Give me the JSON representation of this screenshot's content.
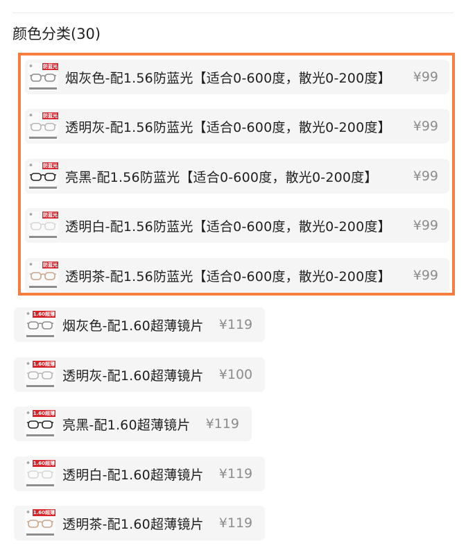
{
  "section": {
    "title": "颜色分类(30)"
  },
  "currency": "¥",
  "options": [
    {
      "label": "烟灰色-配1.56防蓝光【适合0-600度，散光0-200度】",
      "price": "99",
      "thumb_tag": "防蓝光",
      "frame_color": "#8a8a8a"
    },
    {
      "label": "透明灰-配1.56防蓝光【适合0-600度，散光0-200度】",
      "price": "99",
      "thumb_tag": "防蓝光",
      "frame_color": "#b5b5b5"
    },
    {
      "label": "亮黑-配1.56防蓝光【适合0-600度，散光0-200度】",
      "price": "99",
      "thumb_tag": "防蓝光",
      "frame_color": "#222222"
    },
    {
      "label": "透明白-配1.56防蓝光【适合0-600度，散光0-200度】",
      "price": "99",
      "thumb_tag": "防蓝光",
      "frame_color": "#d6d6d6"
    },
    {
      "label": "透明茶-配1.56防蓝光【适合0-600度，散光0-200度】",
      "price": "99",
      "thumb_tag": "防蓝光",
      "frame_color": "#c8a58a"
    },
    {
      "label": "烟灰色-配1.60超薄镜片",
      "price": "119",
      "thumb_tag": "1.60超薄",
      "frame_color": "#8a8a8a"
    },
    {
      "label": "透明灰-配1.60超薄镜片",
      "price": "100",
      "thumb_tag": "1.60超薄",
      "frame_color": "#b5b5b5"
    },
    {
      "label": "亮黑-配1.60超薄镜片",
      "price": "119",
      "thumb_tag": "1.60超薄",
      "frame_color": "#222222"
    },
    {
      "label": "透明白-配1.60超薄镜片",
      "price": "119",
      "thumb_tag": "1.60超薄",
      "frame_color": "#d6d6d6"
    },
    {
      "label": "透明茶-配1.60超薄镜片",
      "price": "119",
      "thumb_tag": "1.60超薄",
      "frame_color": "#c8a58a"
    }
  ],
  "selection_highlight_color": "#f47d3f",
  "icons": {
    "thumbnail": "eyeglasses-product-icon"
  }
}
